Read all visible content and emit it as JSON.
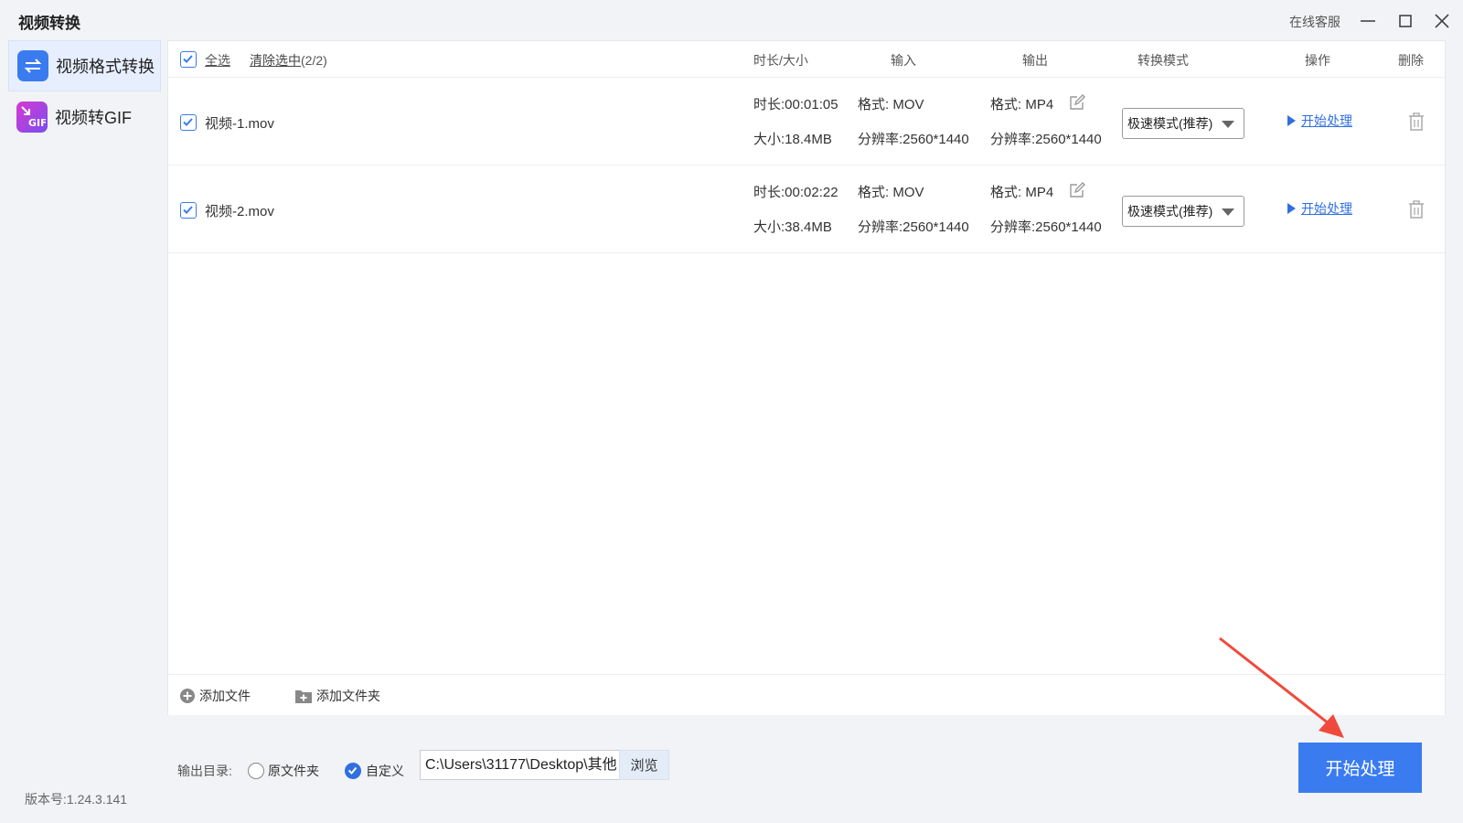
{
  "window": {
    "title": "视频转换",
    "support_label": "在线客服"
  },
  "sidebar": {
    "items": [
      {
        "label": "视频格式转换",
        "icon": "convert-arrows-icon",
        "active": true
      },
      {
        "label": "视频转GIF",
        "icon": "gif-icon",
        "active": false
      }
    ],
    "version": "版本号:1.24.3.141"
  },
  "table": {
    "select_all": "全选",
    "clear_selected": "清除选中",
    "selected_count": "(2/2)",
    "headers": {
      "duration_size": "时长/大小",
      "input": "输入",
      "output": "输出",
      "mode": "转换模式",
      "action": "操作",
      "delete": "删除"
    },
    "rows": [
      {
        "checked": true,
        "name": "视频-1.mov",
        "duration": "时长:00:01:05",
        "size": "大小:18.4MB",
        "in_format": "格式: MOV",
        "in_resolution": "分辨率:2560*1440",
        "out_format": "格式: MP4",
        "out_resolution": "分辨率:2560*1440",
        "mode": "极速模式(推荐)",
        "action": "开始处理"
      },
      {
        "checked": true,
        "name": "视频-2.mov",
        "duration": "时长:00:02:22",
        "size": "大小:38.4MB",
        "in_format": "格式: MOV",
        "in_resolution": "分辨率:2560*1440",
        "out_format": "格式: MP4",
        "out_resolution": "分辨率:2560*1440",
        "mode": "极速模式(推荐)",
        "action": "开始处理"
      }
    ]
  },
  "footer": {
    "add_file": "添加文件",
    "add_folder": "添加文件夹"
  },
  "output": {
    "label": "输出目录:",
    "option_original": "原文件夹",
    "option_custom": "自定义",
    "selected": "自定义",
    "path": "C:\\Users\\31177\\Desktop\\其他",
    "browse": "浏览",
    "start": "开始处理"
  },
  "colors": {
    "accent": "#3a7bf0",
    "annotation_arrow": "#f04a3c"
  }
}
